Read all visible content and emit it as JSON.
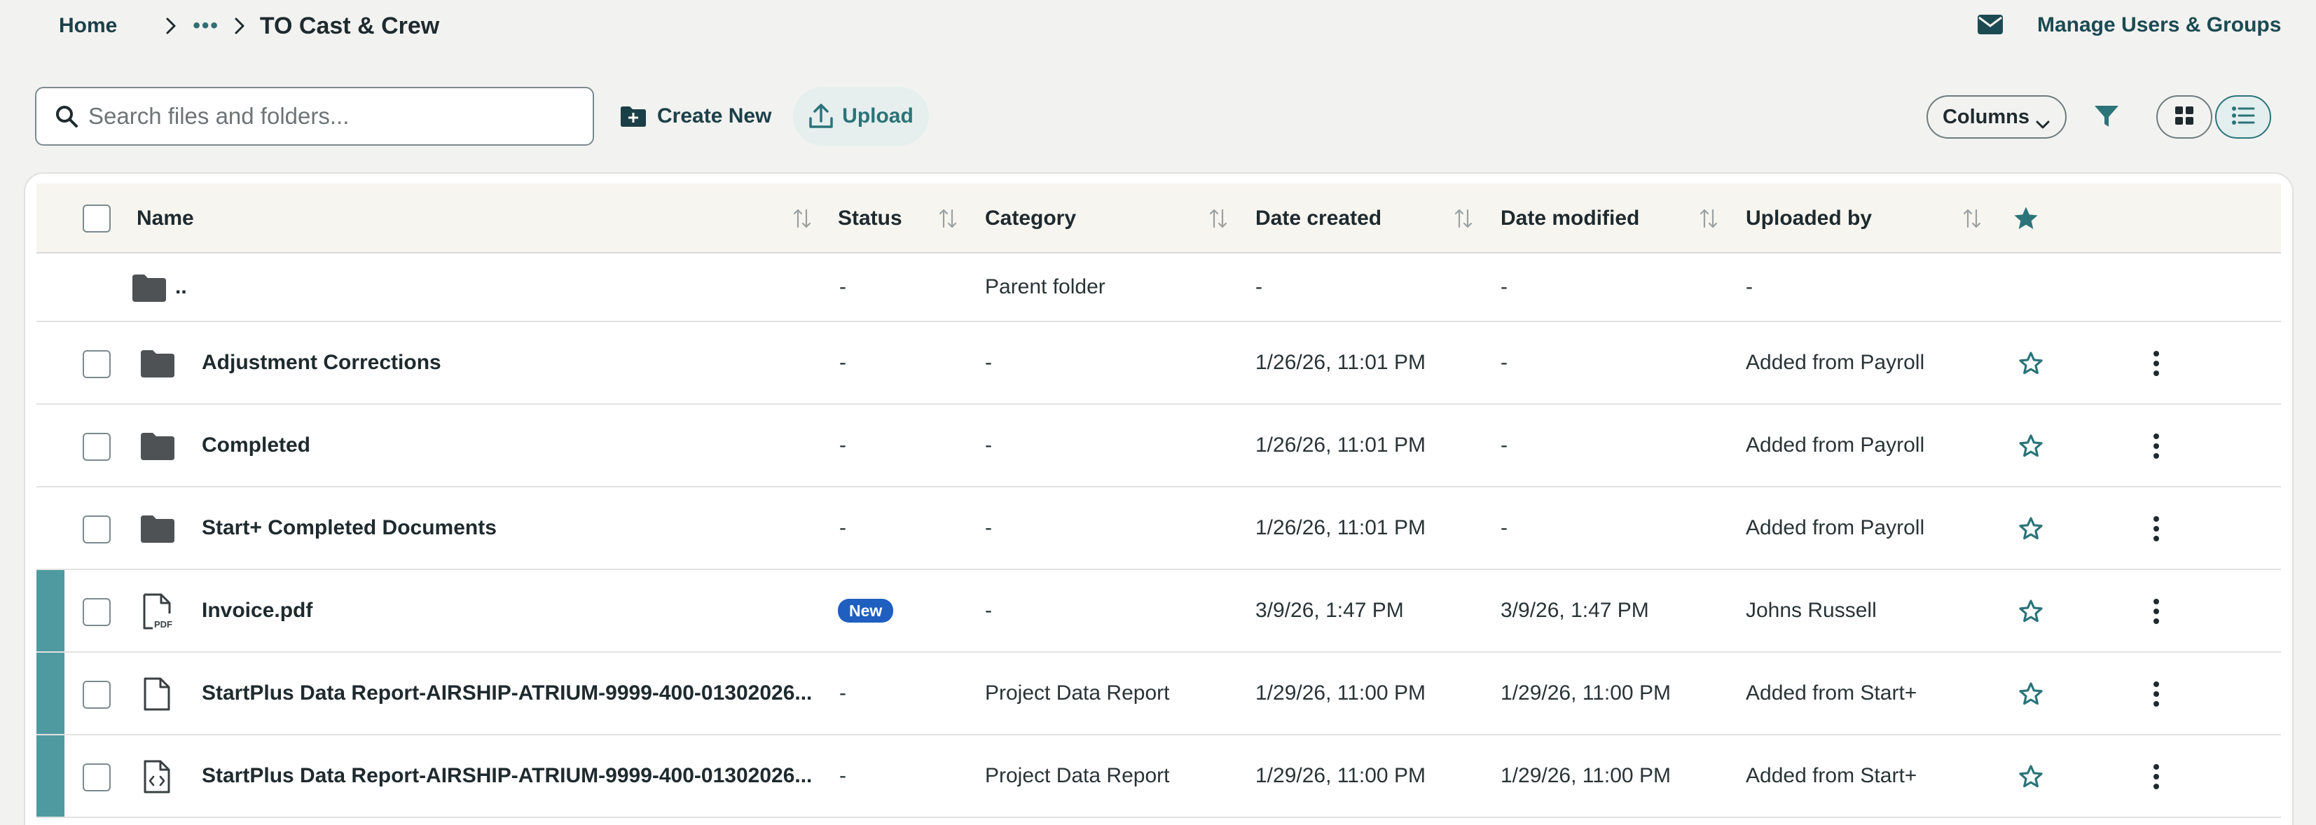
{
  "breadcrumb": {
    "home": "Home",
    "ellipsis": "•••",
    "current": "TO Cast & Crew"
  },
  "header": {
    "manage_label": "Manage Users & Groups",
    "mail_icon": "mail-icon"
  },
  "toolbar": {
    "search_placeholder": "Search files and folders...",
    "create_new_label": "Create New",
    "upload_label": "Upload",
    "columns_label": "Columns"
  },
  "table": {
    "headers": {
      "name": "Name",
      "status": "Status",
      "category": "Category",
      "date_created": "Date created",
      "date_modified": "Date modified",
      "uploaded_by": "Uploaded by"
    },
    "parent_row": {
      "name": "..",
      "status": "-",
      "category": "Parent folder",
      "date_created": "-",
      "date_modified": "-",
      "uploaded_by": "-"
    },
    "rows": [
      {
        "name": "Adjustment Corrections",
        "icon": "folder-icon",
        "status": "-",
        "category": "-",
        "date_created": "1/26/26, 11:01 PM",
        "date_modified": "-",
        "uploaded_by": "Added from Payroll"
      },
      {
        "name": "Completed",
        "icon": "folder-icon",
        "status": "-",
        "category": "-",
        "date_created": "1/26/26, 11:01 PM",
        "date_modified": "-",
        "uploaded_by": "Added from Payroll"
      },
      {
        "name": "Start+ Completed Documents",
        "icon": "folder-icon",
        "status": "-",
        "category": "-",
        "date_created": "1/26/26, 11:01 PM",
        "date_modified": "-",
        "uploaded_by": "Added from Payroll"
      },
      {
        "name": "Invoice.pdf",
        "icon": "pdf-file-icon",
        "status_badge": "New",
        "category": "-",
        "date_created": "3/9/26, 1:47 PM",
        "date_modified": "3/9/26, 1:47 PM",
        "uploaded_by": "Johns Russell"
      },
      {
        "name": "StartPlus Data Report-AIRSHIP-ATRIUM-9999-400-01302026...",
        "icon": "file-icon",
        "status": "-",
        "category": "Project Data Report",
        "date_created": "1/29/26, 11:00 PM",
        "date_modified": "1/29/26, 11:00 PM",
        "uploaded_by": "Added from Start+"
      },
      {
        "name": "StartPlus Data Report-AIRSHIP-ATRIUM-9999-400-01302026...",
        "icon": "code-file-icon",
        "status": "-",
        "category": "Project Data Report",
        "date_created": "1/29/26, 11:00 PM",
        "date_modified": "1/29/26, 11:00 PM",
        "uploaded_by": "Added from Start+"
      }
    ]
  },
  "colors": {
    "accent": "#2b7479",
    "row_accent": "#4f9aa0",
    "badge": "#1f5fc0",
    "folder": "#4f5254"
  }
}
